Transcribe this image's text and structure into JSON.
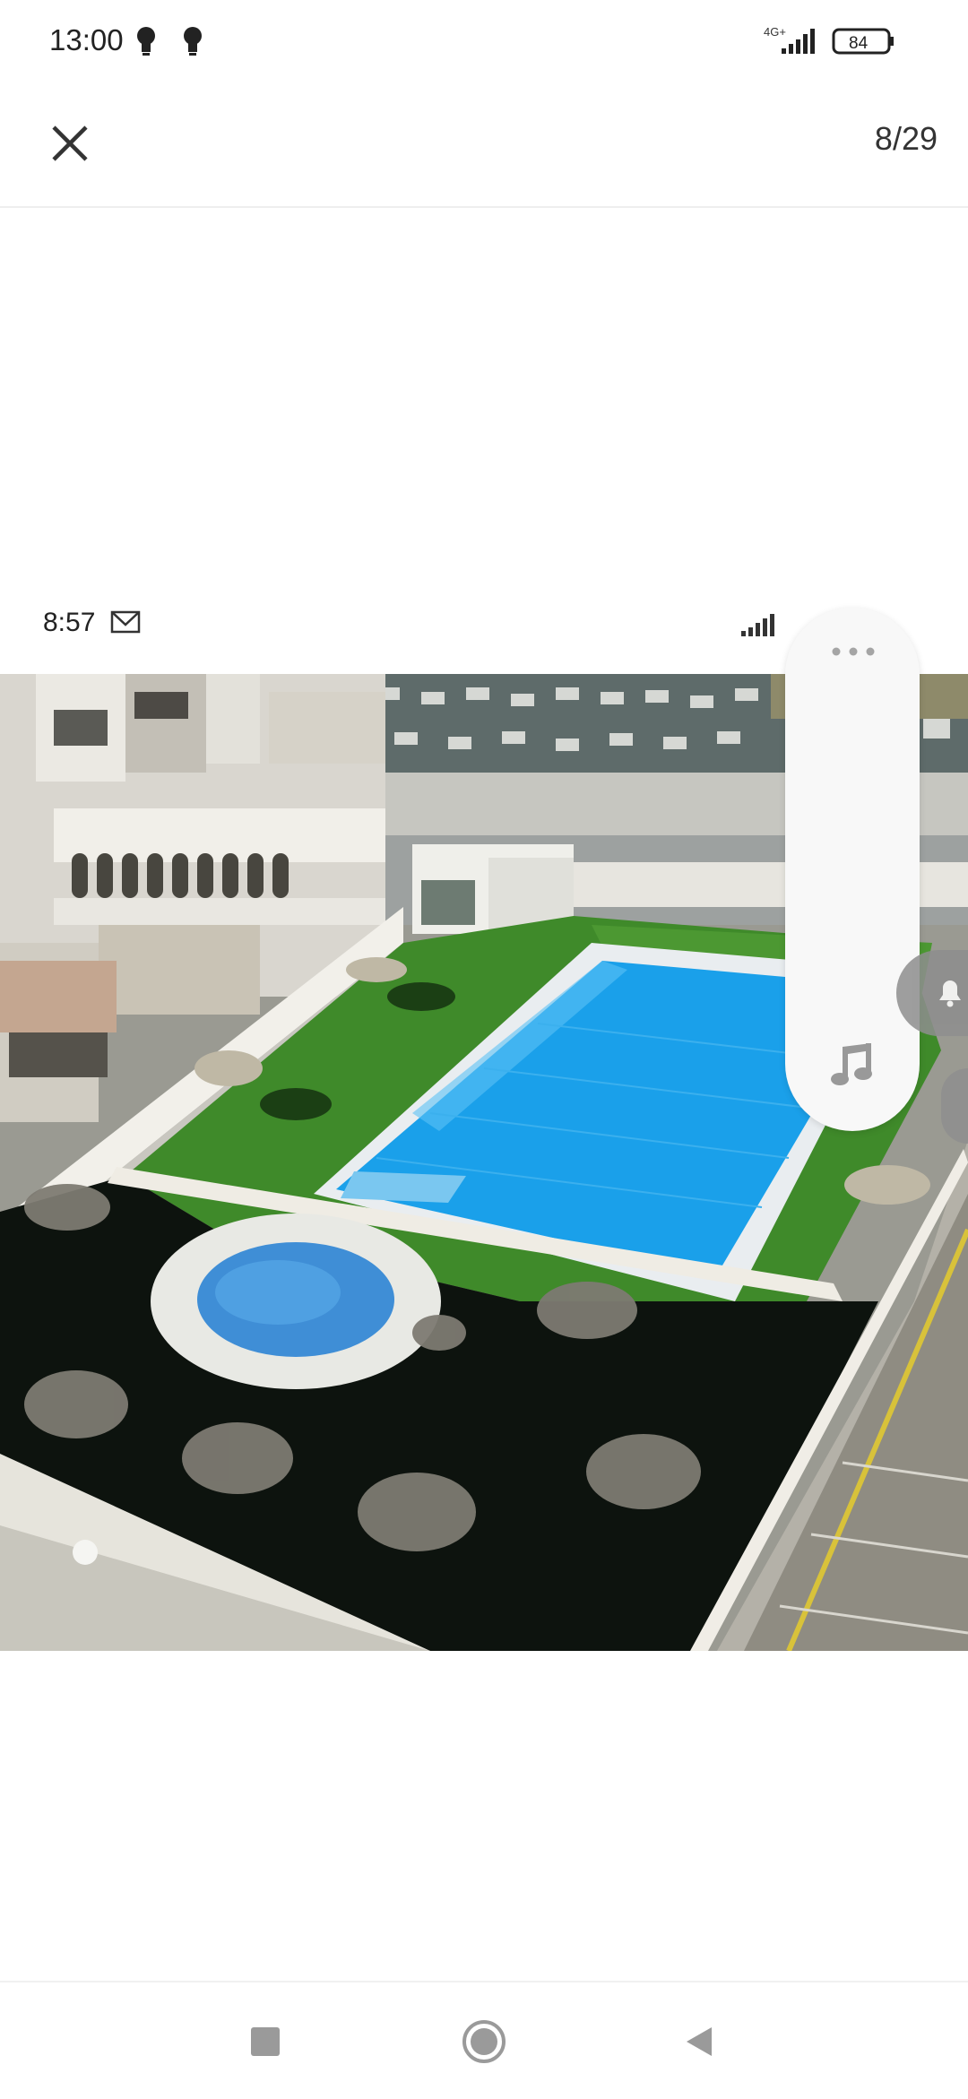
{
  "status_bar": {
    "time": "13:00",
    "network": "4G+",
    "battery": "84",
    "icons": [
      "bulb-icon",
      "bulb-icon",
      "signal-icon",
      "battery-icon"
    ]
  },
  "top_bar": {
    "close_icon": "close-icon",
    "counter": "8/29"
  },
  "screenshot_content": {
    "time": "8:57",
    "icons": [
      "gmail-icon",
      "signal-icon"
    ],
    "photo_alt": "Apartment complex with swimming pool"
  },
  "floating_panel": {
    "icons": [
      "more-dots-icon",
      "music-note-icon"
    ]
  },
  "side_bubbles": {
    "icons": [
      "bell-icon",
      "bubble-icon"
    ]
  },
  "nav_bar": {
    "icons": [
      "recent-apps-icon",
      "home-icon",
      "back-icon"
    ]
  },
  "colors": {
    "pool": "#1aa0ea",
    "grass": "#3f8a2a",
    "dark_turf": "#0d130e",
    "panel": "#f8f8f8"
  }
}
